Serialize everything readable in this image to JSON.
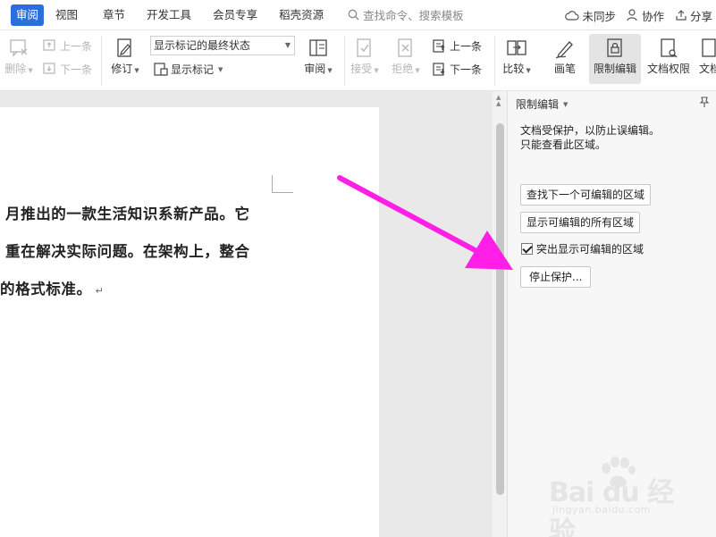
{
  "menubar": {
    "tabs": [
      {
        "label": "审阅",
        "active": true
      },
      {
        "label": "视图"
      },
      {
        "label": "章节"
      },
      {
        "label": "开发工具"
      },
      {
        "label": "会员专享"
      },
      {
        "label": "稻壳资源"
      }
    ],
    "search_label": "查找命令、搜索模板",
    "unsync_label": "未同步",
    "collab_label": "协作",
    "share_label": "分享"
  },
  "ribbon": {
    "delete_label": "删除",
    "prev_comment_label": "上一条",
    "next_comment_label": "下一条",
    "revise_label": "修订",
    "markup_mode_value": "显示标记的最终状态",
    "show_markup_label": "显示标记",
    "review_label": "审阅",
    "accept_label": "接受",
    "reject_label": "拒绝",
    "prev_change_label": "上一条",
    "next_change_label": "下一条",
    "compare_label": "比较",
    "ink_label": "画笔",
    "restrict_edit_label": "限制编辑",
    "doc_permission_label": "文档权限",
    "doc_more_label": "文档"
  },
  "document": {
    "lines": [
      "月推出的一款生活知识系新产品。它",
      "重在解决实际问题。在架构上，整合",
      "的格式标准。"
    ],
    "para_mark": "↵"
  },
  "pane": {
    "title": "限制编辑",
    "info_line1": "文档受保护，以防止误编辑。",
    "info_line2": "只能查看此区域。",
    "find_next_label": "查找下一个可编辑的区域",
    "show_all_label": "显示可编辑的所有区域",
    "highlight_label": "突出显示可编辑的区域",
    "highlight_checked": true,
    "stop_protect_label": "停止保护..."
  },
  "watermark": {
    "logo": "Bai du 经验",
    "sub": "jingyan.baidu.com"
  },
  "colors": {
    "active_tab": "#2b6fdc",
    "arrow": "#ff1fe6"
  }
}
